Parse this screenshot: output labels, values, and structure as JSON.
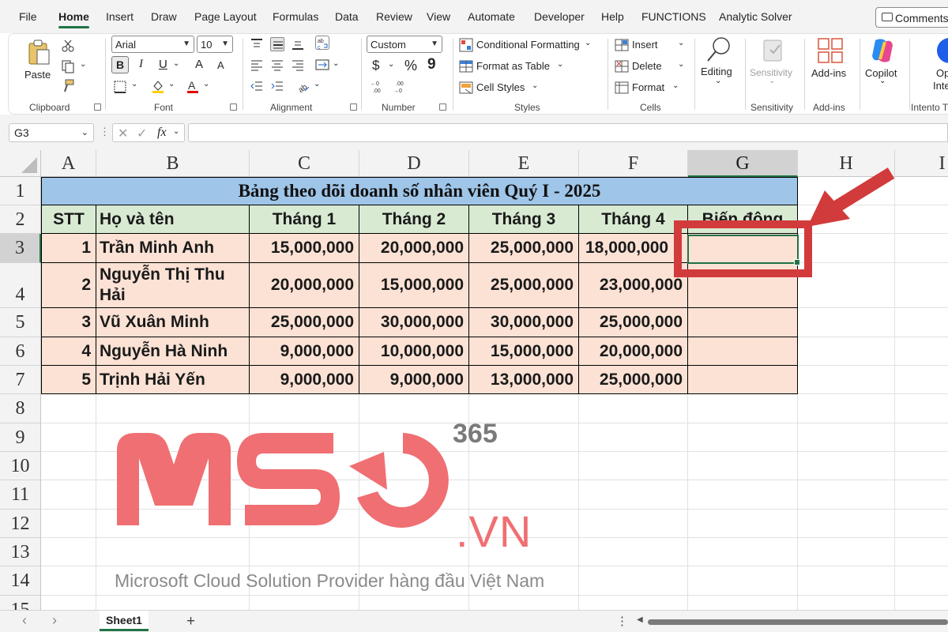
{
  "menu": {
    "items": [
      "File",
      "Home",
      "Insert",
      "Draw",
      "Page Layout",
      "Formulas",
      "Data",
      "Review",
      "View",
      "Automate",
      "Developer",
      "Help",
      "FUNCTIONS",
      "Analytic Solver"
    ],
    "active": "Home",
    "comments": "Comments"
  },
  "ribbon": {
    "clipboard": {
      "paste": "Paste",
      "label": "Clipboard"
    },
    "font": {
      "name": "Arial",
      "size": "10",
      "bold": "B",
      "italic": "I",
      "underline": "U",
      "grow": "A",
      "shrink": "A",
      "label": "Font"
    },
    "alignment": {
      "label": "Alignment"
    },
    "number": {
      "format": "Custom",
      "currency": "$",
      "percent": "%",
      "comma": "9",
      "label": "Number"
    },
    "styles": {
      "conditional": "Conditional Formatting",
      "table": "Format as Table",
      "cell_styles": "Cell Styles",
      "label": "Styles"
    },
    "cells": {
      "insert": "Insert",
      "delete": "Delete",
      "format": "Format",
      "label": "Cells"
    },
    "editing": {
      "label": "Editing"
    },
    "sensitivity": {
      "button": "Sensitivity",
      "label": "Sensitivity"
    },
    "addins": {
      "button": "Add-ins",
      "label": "Add-ins"
    },
    "copilot": {
      "button": "Copilot"
    },
    "intento": {
      "button": "Op",
      "button2": "Inte",
      "label": "Intento T"
    }
  },
  "formula_bar": {
    "name_box": "G3",
    "fx": "fx",
    "formula": ""
  },
  "sheet": {
    "columns": [
      "A",
      "B",
      "C",
      "D",
      "E",
      "F",
      "G",
      "H",
      "I"
    ],
    "selected_column": "G",
    "rows": [
      "1",
      "2",
      "3",
      "4",
      "5",
      "6",
      "7",
      "8",
      "9",
      "10",
      "11",
      "12",
      "13",
      "14",
      "15"
    ],
    "selected_row": "3",
    "title": "Bảng theo dõi doanh số nhân viên Quý I - 2025",
    "headers": [
      "STT",
      "Họ và tên",
      "Tháng 1",
      "Tháng 2",
      "Tháng 3",
      "Tháng 4",
      "Biến động"
    ],
    "data": [
      [
        "1",
        "Trần Minh Anh",
        "15,000,000",
        "20,000,000",
        "25,000,000",
        "18,000,000",
        ""
      ],
      [
        "2",
        "Nguyễn Thị Thu Hải",
        "20,000,000",
        "15,000,000",
        "25,000,000",
        "23,000,000",
        ""
      ],
      [
        "3",
        "Vũ Xuân Minh",
        "25,000,000",
        "30,000,000",
        "30,000,000",
        "25,000,000",
        ""
      ],
      [
        "4",
        "Nguyễn Hà Ninh",
        "9,000,000",
        "10,000,000",
        "15,000,000",
        "20,000,000",
        ""
      ],
      [
        "5",
        "Trịnh Hải Yến",
        "9,000,000",
        "9,000,000",
        "13,000,000",
        "25,000,000",
        ""
      ]
    ],
    "name_line1": "Nguyễn Thị Thu",
    "name_line2": "Hải"
  },
  "watermark": {
    "brand": "MSO",
    "number": "365",
    "domain": ".VN",
    "tagline": "Microsoft Cloud Solution Provider hàng đầu Việt Nam"
  },
  "bottom": {
    "sheet_tab": "Sheet1",
    "add_sheet": "+",
    "prev": "‹",
    "next": "›",
    "more": "⋮"
  },
  "colors": {
    "accent": "#217346",
    "annotation": "#d23b3b",
    "title_fill": "#9fc5e8",
    "header_fill": "#d9ead3",
    "body_fill": "#fbe2d5",
    "watermark": "#ef6f73"
  }
}
